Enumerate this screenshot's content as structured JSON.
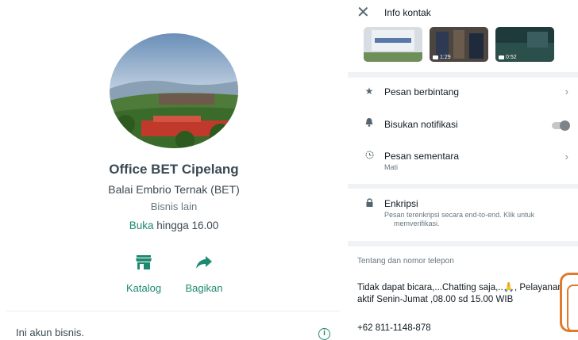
{
  "profile": {
    "name": "Office BET Cipelang",
    "subtitle": "Balai Embrio Ternak (BET)",
    "category": "Bisnis lain",
    "status_open": "Buka",
    "hours": " hingga 16.00"
  },
  "actions": [
    {
      "label": "Katalog",
      "icon": "store-icon"
    },
    {
      "label": "Bagikan",
      "icon": "share-arrow-icon"
    }
  ],
  "business_note": "Ini akun bisnis.",
  "contact_info": {
    "title": "Info kontak",
    "media": [
      {
        "duration": ""
      },
      {
        "duration": "1:29"
      },
      {
        "duration": "0:52"
      }
    ],
    "starred": "Pesan berbintang",
    "mute": "Bisukan notifikasi",
    "disappearing": "Pesan sementara",
    "disappearing_value": "Mati",
    "encryption_title": "Enkripsi",
    "encryption_desc_1": "Pesan terenkripsi secara end-to-end. Klik untuk",
    "encryption_desc_2": "memverifikasi.",
    "about_label": "Tentang dan nomor telepon",
    "about_line_1": "Tidak dapat bicara,...Chatting saja,..🙏, Pelayanan",
    "about_line_2": "aktif Senin-Jumat ,08.00 sd 15.00 WIB",
    "phone": "+62 811-1148-878"
  },
  "colors": {
    "accent": "#1d8a6f",
    "panel_bg": "#f0f2f5"
  }
}
